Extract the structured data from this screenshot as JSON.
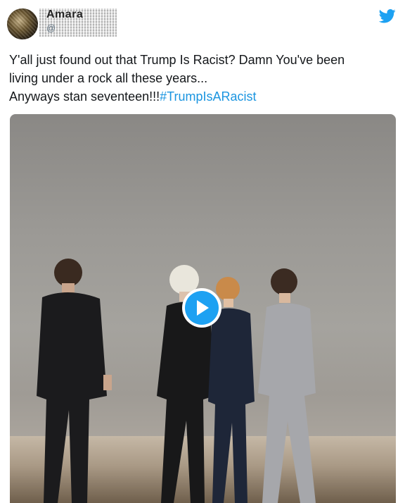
{
  "tweet": {
    "display_name": "Amara",
    "handle": "@",
    "text_line1": "Y'all just found out that Trump Is Racist? Damn You've been",
    "text_line2": "living under a rock all these years...",
    "text_line3": "Anyways stan seventeen!!!",
    "hashtag": "#TrumpIsARacist"
  },
  "icons": {
    "brand": "twitter-bird-icon",
    "media_control": "play-icon"
  },
  "colors": {
    "hashtag": "#1b95e0",
    "twitter_blue": "#1da1f2",
    "text": "#14171a"
  }
}
